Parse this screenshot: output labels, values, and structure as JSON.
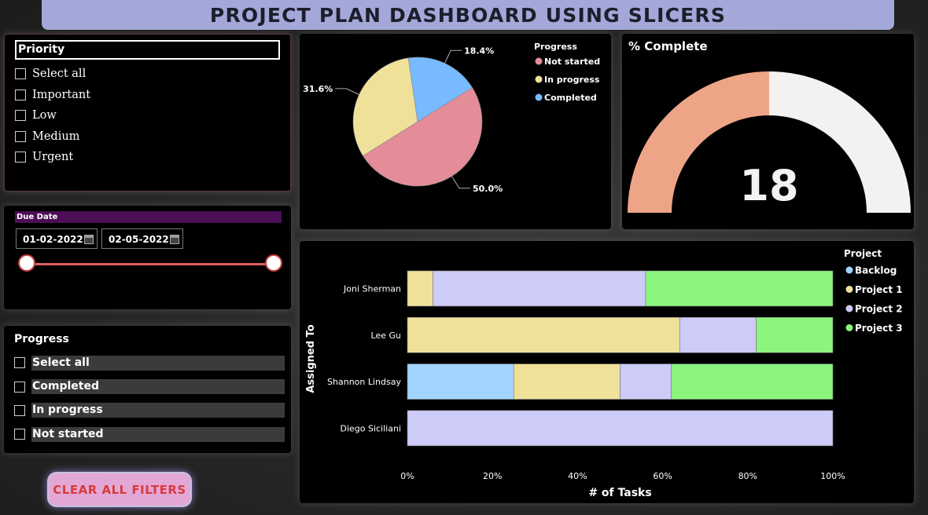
{
  "header": {
    "title": "PROJECT PLAN DASHBOARD USING SLICERS"
  },
  "priority_slicer": {
    "title": "Priority",
    "items": [
      "Select all",
      "Important",
      "Low",
      "Medium",
      "Urgent"
    ]
  },
  "due_date": {
    "title": "Due Date",
    "start": "01-02-2022",
    "end": "02-05-2022"
  },
  "progress_slicer": {
    "title": "Progress",
    "items": [
      "Select all",
      "Completed",
      "In progress",
      "Not started"
    ]
  },
  "clear_button": {
    "label": "CLEAR ALL FILTERS"
  },
  "gauge": {
    "title": "% Complete",
    "value": "18",
    "fraction": 0.18,
    "fill_color": "#eea587",
    "rest_color": "#f3f2f0"
  },
  "chart_data": [
    {
      "type": "pie",
      "legend_title": "Progress",
      "legend_position": "top-right",
      "labels": [
        "Not started",
        "In progress",
        "Completed"
      ],
      "values": [
        50.0,
        31.6,
        18.4
      ],
      "value_labels": [
        "50.0%",
        "31.6%",
        "18.4%"
      ],
      "colors": [
        "#e48c98",
        "#efe19a",
        "#77baff"
      ]
    },
    {
      "type": "bar",
      "orientation": "horizontal",
      "stacked": "100%",
      "categories": [
        "Joni Sherman",
        "Lee Gu",
        "Shannon Lindsay",
        "Diego Siciliani"
      ],
      "xlabel": "# of Tasks",
      "ylabel": "Assigned To",
      "xticks": [
        "0%",
        "20%",
        "40%",
        "60%",
        "80%",
        "100%"
      ],
      "legend_title": "Project",
      "legend_position": "right",
      "series": [
        {
          "name": "Backlog",
          "color": "#a3d4ff",
          "values": [
            0,
            0,
            25,
            0
          ]
        },
        {
          "name": "Project 1",
          "color": "#efe19a",
          "values": [
            6,
            64,
            25,
            0
          ]
        },
        {
          "name": "Project 2",
          "color": "#cdcbf7",
          "values": [
            50,
            18,
            12,
            100
          ]
        },
        {
          "name": "Project 3",
          "color": "#8cf57e",
          "values": [
            44,
            18,
            38,
            0
          ]
        }
      ]
    }
  ]
}
